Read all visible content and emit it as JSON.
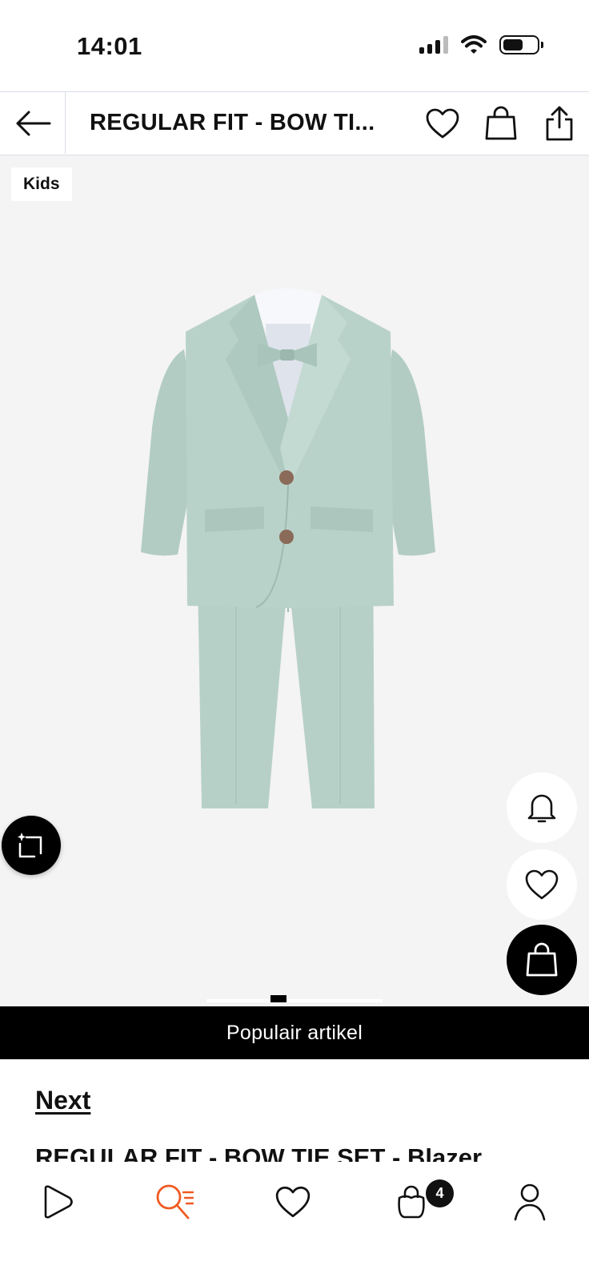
{
  "status_bar": {
    "time": "14:01",
    "battery_level": 0.6
  },
  "header": {
    "title": "REGULAR FIT - BOW TI..."
  },
  "product": {
    "badge": "Kids",
    "banner": "Populair artikel",
    "brand": "Next",
    "name": "REGULAR FIT - BOW TIE SET - Blazer"
  },
  "gallery": {
    "pager_position": 0.5
  },
  "bottom_nav": {
    "items": [
      {
        "icon": "play-icon",
        "active": false
      },
      {
        "icon": "search-list-icon",
        "active": true
      },
      {
        "icon": "heart-icon",
        "active": false
      },
      {
        "icon": "bag-icon",
        "active": false
      },
      {
        "icon": "user-icon",
        "active": false
      }
    ],
    "cart_count": "4"
  },
  "colors": {
    "accent": "#f05a22",
    "suit": "#b5cfc6",
    "background_gray": "#f4f4f4"
  }
}
